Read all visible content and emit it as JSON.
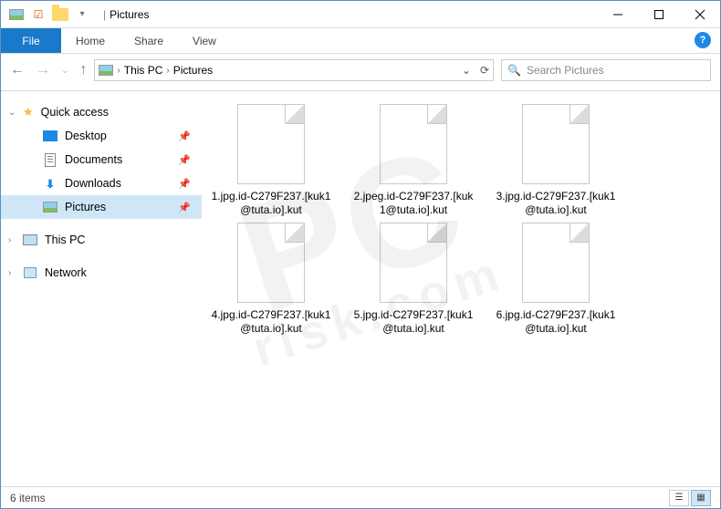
{
  "titlebar": {
    "title": "Pictures",
    "qat_dropdown": "▾"
  },
  "ribbon": {
    "file": "File",
    "tabs": [
      "Home",
      "Share",
      "View"
    ],
    "help": "?"
  },
  "nav": {
    "back": "←",
    "forward": "→",
    "recent": "▾",
    "up": "↑",
    "breadcrumbs": [
      {
        "label": "This PC"
      },
      {
        "label": "Pictures"
      }
    ],
    "history_chev": "⌄",
    "refresh": "⟳"
  },
  "search": {
    "placeholder": "Search Pictures",
    "icon": "🔍"
  },
  "sidebar": {
    "quick_access": "Quick access",
    "items": [
      {
        "label": "Desktop",
        "icon": "desktop",
        "pinned": true
      },
      {
        "label": "Documents",
        "icon": "doc",
        "pinned": true
      },
      {
        "label": "Downloads",
        "icon": "download",
        "pinned": true
      },
      {
        "label": "Pictures",
        "icon": "pic",
        "pinned": true,
        "selected": true
      }
    ],
    "this_pc": "This PC",
    "network": "Network"
  },
  "files": [
    {
      "name": "1.jpg.id-C279F237.[kuk1@tuta.io].kut"
    },
    {
      "name": "2.jpeg.id-C279F237.[kuk1@tuta.io].kut"
    },
    {
      "name": "3.jpg.id-C279F237.[kuk1@tuta.io].kut"
    },
    {
      "name": "4.jpg.id-C279F237.[kuk1@tuta.io].kut"
    },
    {
      "name": "5.jpg.id-C279F237.[kuk1@tuta.io].kut"
    },
    {
      "name": "6.jpg.id-C279F237.[kuk1@tuta.io].kut"
    }
  ],
  "statusbar": {
    "count_label": "6 items"
  },
  "watermark": {
    "l1": "PC",
    "l2": "risk.com"
  }
}
